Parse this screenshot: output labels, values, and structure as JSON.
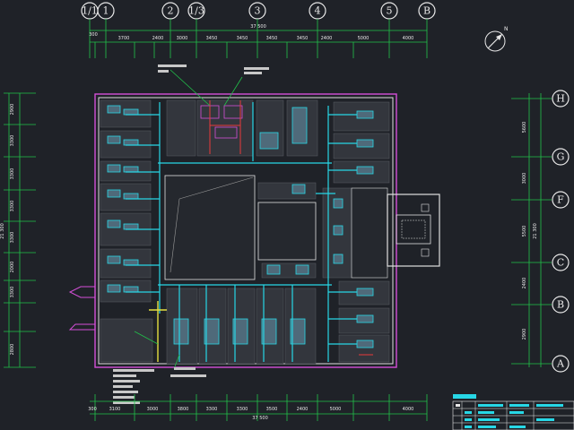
{
  "grid_top": [
    "1/1",
    "1",
    "2",
    "1/3",
    "3",
    "4",
    "5",
    "B"
  ],
  "grid_right": [
    "H",
    "G",
    "F",
    "C",
    "B",
    "A"
  ],
  "dims_top_total": "37 500",
  "dims_top": [
    "3700",
    "2400",
    "3000",
    "3450",
    "3450",
    "3450",
    "3450",
    "2400",
    "5000",
    "4000"
  ],
  "dims_bottom_total": "37 500",
  "dims_bottom": [
    "3100",
    "3000",
    "3800",
    "3300",
    "3300",
    "3500",
    "2400",
    "5000",
    "4000"
  ],
  "dims_left": [
    "2900",
    "3300",
    "3300",
    "3300",
    "3300",
    "2000",
    "3300",
    "2800"
  ],
  "dims_right": [
    "5600",
    "3000",
    "5500",
    "2400",
    "2900"
  ],
  "dims_side_total": "21 300",
  "dims_edge": "300",
  "north_mark": "N"
}
